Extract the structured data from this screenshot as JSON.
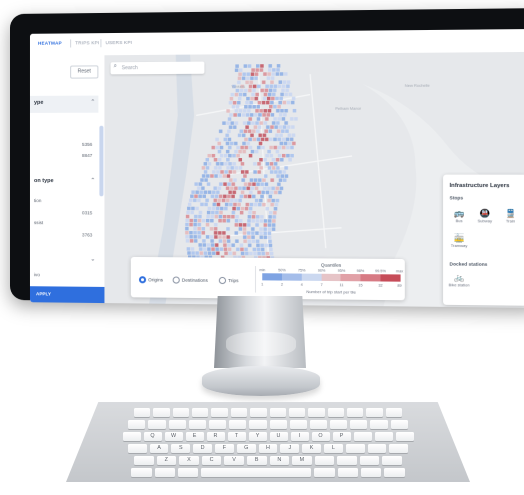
{
  "app": {
    "tabs": [
      {
        "label": "HEATMAP",
        "active": true
      },
      {
        "label": "TRIPS KPI",
        "active": false
      },
      {
        "label": "USERS KPI",
        "active": false
      }
    ],
    "menu_glyph": "≡"
  },
  "sidebar": {
    "reset_label": "Reset",
    "sections": [
      {
        "title": "ype",
        "rows": [
          {
            "label": "",
            "value": "5356"
          },
          {
            "label": "",
            "value": "8847"
          }
        ]
      },
      {
        "title": "on type",
        "rows": [
          {
            "label": "tion",
            "value": ""
          },
          {
            "label": "ssist",
            "value": "0315"
          },
          {
            "label": "",
            "value": "3763"
          }
        ]
      },
      {
        "title": "ivo",
        "rows": []
      }
    ],
    "apply_label": "APPLY"
  },
  "map": {
    "search_placeholder": "Search",
    "place_labels": [
      "Pelham Manor",
      "Yonkers",
      "New Rochelle"
    ],
    "heat_colors": [
      "#8fb0e6",
      "#aac3ee",
      "#c9d6f2",
      "#e4b9bd",
      "#d98f97",
      "#c35a66"
    ]
  },
  "infrastructure": {
    "title": "Infrastructure Layers",
    "stops_label": "Stops",
    "stops": [
      {
        "icon": "bus-icon",
        "glyph": "🚌",
        "label": "Bus"
      },
      {
        "icon": "subway-icon",
        "glyph": "🚇",
        "label": "Subway"
      },
      {
        "icon": "train-icon",
        "glyph": "🚆",
        "label": "Train"
      },
      {
        "icon": "tramway-icon",
        "glyph": "🚋",
        "label": "Tramway"
      }
    ],
    "docked_label": "Docked stations",
    "docked": [
      {
        "icon": "bike-station-icon",
        "glyph": "🚲",
        "label": "Bike station"
      }
    ]
  },
  "legend": {
    "options": [
      {
        "label": "Origins",
        "selected": true
      },
      {
        "label": "Destinations",
        "selected": false
      },
      {
        "label": "Trips",
        "selected": false
      }
    ],
    "quantiles_title": "Quantiles",
    "quantile_labels": [
      "min",
      "50%",
      "75%",
      "90%",
      "95%",
      "98%",
      "99.5%",
      "max"
    ],
    "count_labels": [
      "1",
      "2",
      "4",
      "7",
      "11",
      "15",
      "32",
      "89"
    ],
    "colors": [
      "#7ea3e3",
      "#a4bdea",
      "#cbd8f0",
      "#e6c4c7",
      "#e1a1a7",
      "#d77a84",
      "#c64c59"
    ],
    "axis_caption": "Number of trip start per tile"
  },
  "keyboard": {
    "rows": [
      [
        "",
        "",
        "",
        "",
        "",
        "",
        "",
        "",
        "",
        "",
        "",
        "",
        "",
        ""
      ],
      [
        "",
        "",
        "",
        "",
        "",
        "",
        "",
        "",
        "",
        "",
        "",
        "",
        "",
        ""
      ],
      [
        "",
        "Q",
        "W",
        "E",
        "R",
        "T",
        "Y",
        "U",
        "I",
        "O",
        "P",
        "",
        "",
        ""
      ],
      [
        "",
        "A",
        "S",
        "D",
        "F",
        "G",
        "H",
        "J",
        "K",
        "L",
        "",
        "",
        ""
      ],
      [
        "",
        "Z",
        "X",
        "C",
        "V",
        "B",
        "N",
        "M",
        "",
        "",
        "",
        ""
      ],
      [
        "",
        "",
        "",
        "",
        "",
        "",
        "",
        ""
      ]
    ]
  }
}
